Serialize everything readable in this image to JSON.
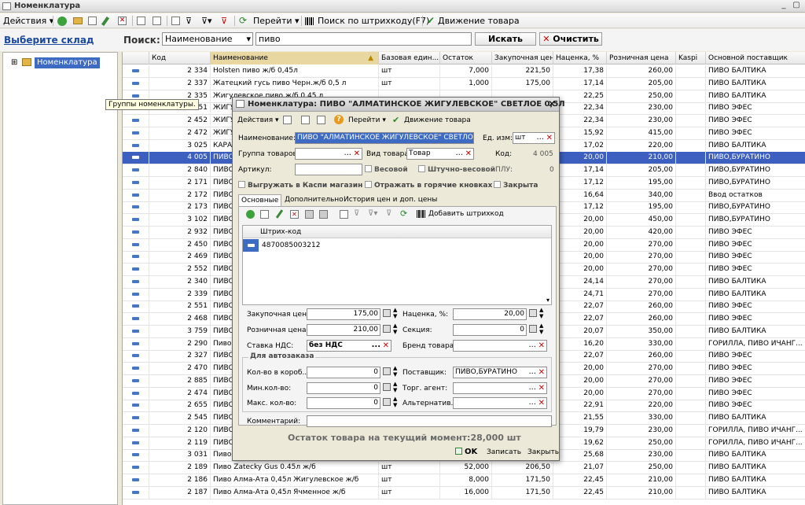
{
  "window": {
    "title": "Номенклатура",
    "minimize": "_",
    "restore": "▢"
  },
  "toolbar": {
    "actions": "Действия",
    "goto": "Перейти",
    "barcode_search": "Поиск по штрихкоду(F7)",
    "movement": "Движение товара"
  },
  "search_row": {
    "store_link": "Выберите склад",
    "search_label": "Поиск:",
    "search_field": "Наименование",
    "search_value": "пиво",
    "search_button": "Искать",
    "clear_button": "Очистить"
  },
  "tree": {
    "root": "Номенклатура",
    "expander": "⊞"
  },
  "tooltip": "Группы номенклатуры.",
  "grid": {
    "columns": [
      "Код",
      "Наименование",
      "Базовая един...",
      "Остаток",
      "Закупочная цена",
      "Наценка, %",
      "Розничная цена",
      "Kaspi",
      "Основной поставщик"
    ],
    "rows": [
      {
        "code": "2 334",
        "name": "Holsten пиво ж/б 0,45л",
        "unit": "шт",
        "stock": "7,000",
        "buy": "221,50",
        "markup": "17,38",
        "retail": "260,00",
        "supplier": "ПИВО БАЛТИКА"
      },
      {
        "code": "2 337",
        "name": "Жатецкий гусь пиво Черн.ж/б 0,5 л",
        "unit": "шт",
        "stock": "1,000",
        "buy": "175,00",
        "markup": "17,14",
        "retail": "205,00",
        "supplier": "ПИВО БАЛТИКА"
      },
      {
        "code": "2 335",
        "name": "Жигулевское пиво ж/б 0,45 л",
        "unit": "",
        "stock": "",
        "buy": "",
        "markup": "22,25",
        "retail": "250,00",
        "supplier": "ПИВО БАЛТИКА"
      },
      {
        "code": "2 451",
        "name": "ЖИГУ",
        "unit": "",
        "stock": "",
        "buy": "",
        "markup": "22,34",
        "retail": "230,00",
        "supplier": "ПИВО ЭФЕС"
      },
      {
        "code": "2 452",
        "name": "ЖИГУ",
        "unit": "",
        "stock": "",
        "buy": "",
        "markup": "22,34",
        "retail": "230,00",
        "supplier": "ПИВО ЭФЕС"
      },
      {
        "code": "2 472",
        "name": "ЖИГУ",
        "unit": "",
        "stock": "",
        "buy": "",
        "markup": "15,92",
        "retail": "415,00",
        "supplier": "ПИВО ЭФЕС"
      },
      {
        "code": "3 025",
        "name": "КАРА",
        "unit": "",
        "stock": "",
        "buy": "",
        "markup": "17,02",
        "retail": "220,00",
        "supplier": "ПИВО БАЛТИКА"
      },
      {
        "code": "4 005",
        "name": "ПИВО",
        "unit": "",
        "stock": "",
        "buy": "",
        "markup": "20,00",
        "retail": "210,00",
        "supplier": "ПИВО,БУРАТИНО"
      },
      {
        "code": "2 840",
        "name": "ПИВО",
        "unit": "",
        "stock": "",
        "buy": "",
        "markup": "17,14",
        "retail": "205,00",
        "supplier": "ПИВО,БУРАТИНО"
      },
      {
        "code": "2 171",
        "name": "ПИВО",
        "unit": "",
        "stock": "",
        "buy": "",
        "markup": "17,12",
        "retail": "195,00",
        "supplier": "ПИВО,БУРАТИНО"
      },
      {
        "code": "2 172",
        "name": "ПИВО",
        "unit": "",
        "stock": "",
        "buy": "",
        "markup": "16,64",
        "retail": "340,00",
        "supplier": "Ввод остатков"
      },
      {
        "code": "2 173",
        "name": "ПИВО",
        "unit": "",
        "stock": "",
        "buy": "",
        "markup": "17,12",
        "retail": "195,00",
        "supplier": "ПИВО,БУРАТИНО"
      },
      {
        "code": "3 102",
        "name": "ПИВО",
        "unit": "",
        "stock": "",
        "buy": "",
        "markup": "20,00",
        "retail": "450,00",
        "supplier": "ПИВО,БУРАТИНО"
      },
      {
        "code": "2 932",
        "name": "ПИВО",
        "unit": "",
        "stock": "",
        "buy": "",
        "markup": "20,00",
        "retail": "420,00",
        "supplier": "ПИВО ЭФЕС"
      },
      {
        "code": "2 450",
        "name": "ПИВО",
        "unit": "",
        "stock": "",
        "buy": "",
        "markup": "20,00",
        "retail": "270,00",
        "supplier": "ПИВО ЭФЕС"
      },
      {
        "code": "2 469",
        "name": "ПИВО",
        "unit": "",
        "stock": "",
        "buy": "",
        "markup": "20,00",
        "retail": "270,00",
        "supplier": "ПИВО ЭФЕС"
      },
      {
        "code": "2 552",
        "name": "ПИВО",
        "unit": "",
        "stock": "",
        "buy": "",
        "markup": "20,00",
        "retail": "270,00",
        "supplier": "ПИВО ЭФЕС"
      },
      {
        "code": "2 340",
        "name": "ПИВО",
        "unit": "",
        "stock": "",
        "buy": "",
        "markup": "24,14",
        "retail": "270,00",
        "supplier": "ПИВО БАЛТИКА"
      },
      {
        "code": "2 339",
        "name": "ПИВО",
        "unit": "",
        "stock": "",
        "buy": "",
        "markup": "24,71",
        "retail": "270,00",
        "supplier": "ПИВО БАЛТИКА"
      },
      {
        "code": "2 551",
        "name": "ПИВО",
        "unit": "",
        "stock": "",
        "buy": "",
        "markup": "22,07",
        "retail": "260,00",
        "supplier": "ПИВО ЭФЕС"
      },
      {
        "code": "2 468",
        "name": "ПИВО",
        "unit": "",
        "stock": "",
        "buy": "",
        "markup": "22,07",
        "retail": "260,00",
        "supplier": "ПИВО ЭФЕС"
      },
      {
        "code": "3 759",
        "name": "ПИВО",
        "unit": "",
        "stock": "",
        "buy": "",
        "markup": "20,07",
        "retail": "350,00",
        "supplier": "ПИВО БАЛТИКА"
      },
      {
        "code": "2 290",
        "name": "Пиво",
        "unit": "",
        "stock": "",
        "buy": "",
        "markup": "16,20",
        "retail": "330,00",
        "supplier": "ГОРИЛЛА, ПИВО ИЧАНГ..."
      },
      {
        "code": "2 327",
        "name": "ПИВО",
        "unit": "",
        "stock": "",
        "buy": "",
        "markup": "22,07",
        "retail": "260,00",
        "supplier": "ПИВО ЭФЕС"
      },
      {
        "code": "2 470",
        "name": "ПИВО",
        "unit": "",
        "stock": "",
        "buy": "",
        "markup": "20,00",
        "retail": "270,00",
        "supplier": "ПИВО ЭФЕС"
      },
      {
        "code": "2 885",
        "name": "ПИВО",
        "unit": "",
        "stock": "",
        "buy": "",
        "markup": "20,00",
        "retail": "270,00",
        "supplier": "ПИВО ЭФЕС"
      },
      {
        "code": "2 474",
        "name": "ПИВО",
        "unit": "",
        "stock": "",
        "buy": "",
        "markup": "20,00",
        "retail": "270,00",
        "supplier": "ПИВО ЭФЕС"
      },
      {
        "code": "2 655",
        "name": "ПИВО",
        "unit": "",
        "stock": "",
        "buy": "",
        "markup": "22,91",
        "retail": "220,00",
        "supplier": "ПИВО ЭФЕС"
      },
      {
        "code": "2 545",
        "name": "ПИВО",
        "unit": "",
        "stock": "",
        "buy": "",
        "markup": "21,55",
        "retail": "330,00",
        "supplier": "ПИВО БАЛТИКА"
      },
      {
        "code": "2 120",
        "name": "ПИВО",
        "unit": "",
        "stock": "",
        "buy": "",
        "markup": "19,79",
        "retail": "230,00",
        "supplier": "ГОРИЛЛА, ПИВО ИЧАНГ..."
      },
      {
        "code": "2 119",
        "name": "ПИВО",
        "unit": "",
        "stock": "",
        "buy": "",
        "markup": "19,62",
        "retail": "250,00",
        "supplier": "ГОРИЛЛА, ПИВО ИЧАНГ..."
      },
      {
        "code": "3 031",
        "name": "Пиво",
        "unit": "",
        "stock": "",
        "buy": "",
        "markup": "25,68",
        "retail": "230,00",
        "supplier": "ПИВО БАЛТИКА"
      },
      {
        "code": "2 189",
        "name": "Пиво Zatecky Gus 0.45л ж/б",
        "unit": "шт",
        "stock": "52,000",
        "buy": "206,50",
        "markup": "21,07",
        "retail": "250,00",
        "supplier": "ПИВО БАЛТИКА"
      },
      {
        "code": "2 186",
        "name": "Пиво Алма-Ата 0,45л Жигулевское ж/б",
        "unit": "шт",
        "stock": "8,000",
        "buy": "171,50",
        "markup": "22,45",
        "retail": "210,00",
        "supplier": "ПИВО БАЛТИКА"
      },
      {
        "code": "2 187",
        "name": "Пиво Алма-Ата 0,45л Ячменное ж/б",
        "unit": "шт",
        "stock": "16,000",
        "buy": "171,50",
        "markup": "22,45",
        "retail": "210,00",
        "supplier": "ПИВО БАЛТИКА"
      }
    ]
  },
  "dialog": {
    "title": "Номенклатура: ПИВО \"АЛМАТИНСКОЕ ЖИГУЛЕВСКОЕ\" СВЕТЛОЕ 0,5Л",
    "close": "✕",
    "actions": "Действия",
    "goto": "Перейти",
    "movement": "Движение товара",
    "name_label": "Наименование:",
    "name_value": "ПИВО \"АЛМАТИНСКОЕ ЖИГУЛЕВСКОЕ\" СВЕТЛОЕ",
    "unit_label": "Ед. изм:",
    "unit_value": "шт",
    "group_label": "Группа товаров:",
    "kind_label": "Вид товара:",
    "kind_value": "Товар",
    "code_label": "Код:",
    "code_value": "4 005",
    "article_label": "Артикул:",
    "weight": "Весовой",
    "piece_weight": "Штучно-весовой",
    "plu_label": "ПЛУ:",
    "plu_value": "0",
    "kaspi_export": "Выгружать в Каспи магазин",
    "hot_buttons": "Отражать в горячие кновках",
    "closed": "Закрыта",
    "tabs": [
      "Основные",
      "Дополнительно",
      "История цен и доп. цены"
    ],
    "add_barcode": "Добавить штрихкод",
    "barcode_header": "Штрих-код",
    "barcode_value": "4870085003212",
    "buy_label": "Закупочная цена:",
    "buy_value": "175,00",
    "markup_label": "Наценка, %:",
    "markup_value": "20,00",
    "retail_label": "Розничная цена:",
    "retail_value": "210,00",
    "section_label": "Секция:",
    "section_value": "0",
    "vat_label": "Ставка НДС:",
    "vat_value": "без НДС",
    "brand_label": "Бренд товара:",
    "autoorder": "Для автозаказа",
    "box_label": "Кол-во в короб...",
    "box_value": "0",
    "supplier_label": "Поставщик:",
    "supplier_value": "ПИВО,БУРАТИНО",
    "min_label": "Мин.кол-во:",
    "min_value": "0",
    "agent_label": "Торг. агент:",
    "max_label": "Макс. кол-во:",
    "max_value": "0",
    "alt_label": "Альтернатив...",
    "comment_label": "Комментарий:",
    "stock_text": "Остаток товара на текущий момент:28,000 шт",
    "ok": "OK",
    "save": "Записать",
    "close_btn": "Закрыть"
  }
}
